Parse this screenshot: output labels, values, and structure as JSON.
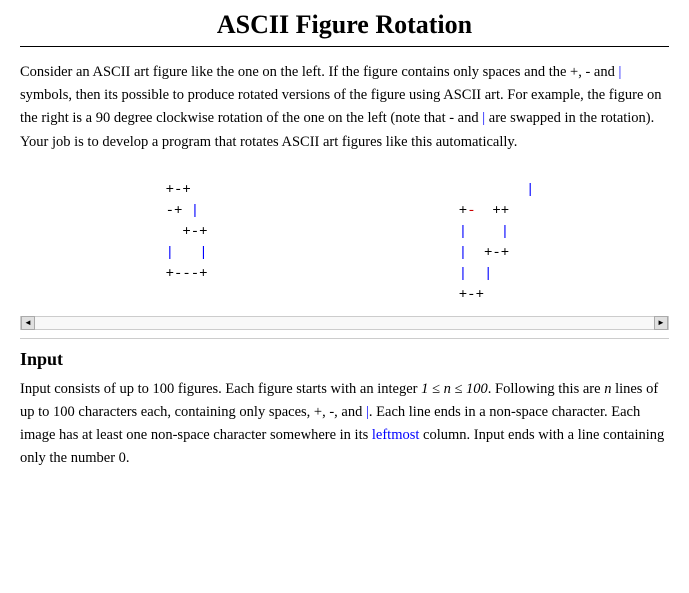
{
  "page": {
    "title": "ASCII Figure Rotation",
    "intro": {
      "text_segments": [
        {
          "text": "Consider an ASCII art figure like the one on the left. If the figure contains only spaces and the +, - and ",
          "type": "normal"
        },
        {
          "text": "|",
          "type": "blue"
        },
        {
          "text": " symbols, then its possible to produce rotated versions of the figure using ASCII art. For example, the figure on the right is a 90 degree clockwise rotation of the one on the left (note that - and ",
          "type": "normal"
        },
        {
          "text": "|",
          "type": "blue"
        },
        {
          "text": " are swapped in the rotation). Your job is to develop a program that rotates ASCII art figures like this automatically.",
          "type": "normal"
        }
      ]
    },
    "figure_left": [
      "+-+",
      "-+ |",
      "  +-+",
      "|   |",
      "+---+"
    ],
    "figure_right": [
      "        |",
      "+- ++",
      "|    |",
      "| +-+",
      "|  |",
      "+-+"
    ],
    "input_section": {
      "title": "Input",
      "text_parts": [
        {
          "text": "Input consists of up to 100 figures. Each figure starts with an integer ",
          "type": "normal"
        },
        {
          "text": "1 ≤ n ≤ 100",
          "type": "math"
        },
        {
          "text": ". Following this are ",
          "type": "normal"
        },
        {
          "text": "n",
          "type": "italic"
        },
        {
          "text": " lines of up to 100 characters each, containing only spaces, +, -, and ",
          "type": "normal"
        },
        {
          "text": "|",
          "type": "blue"
        },
        {
          "text": ". Each line ends in a non-space character. Each image has at least one non-space character somewhere in its leftmost column. Input ends with a line containing only the number 0.",
          "type": "normal"
        }
      ]
    },
    "scrollbar": {
      "left_arrow": "◄",
      "right_arrow": "►"
    }
  }
}
